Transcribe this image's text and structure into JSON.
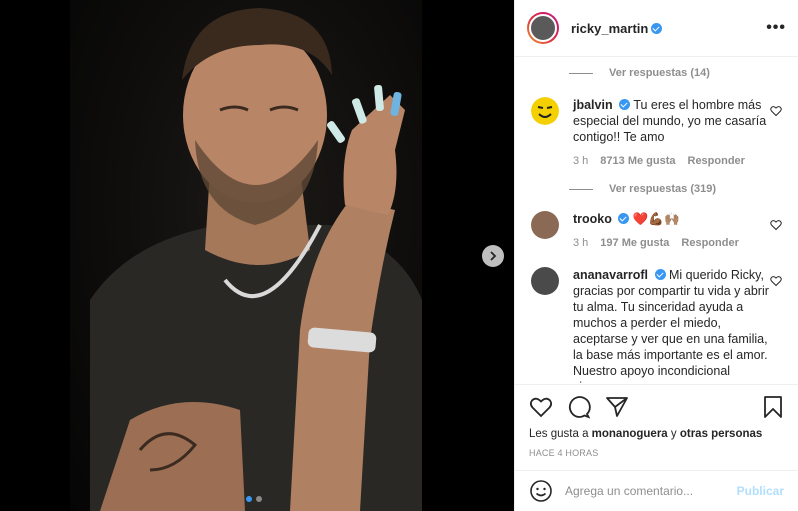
{
  "post": {
    "username": "ricky_martin",
    "more_icon": "more-options-icon",
    "carousel": {
      "total": 2,
      "current": 1
    }
  },
  "comments": {
    "replies_1": "Ver respuestas (14)",
    "c1": {
      "username": "jbalvin",
      "text": "Tu eres el hombre más especial del mundo, yo me casaría contigo!! Te amo",
      "time": "3 h",
      "likes": "8713 Me gusta",
      "reply": "Responder"
    },
    "replies_2": "Ver respuestas (319)",
    "c2": {
      "username": "trooko",
      "text": "❤️💪🏾🙌🏽",
      "time": "3 h",
      "likes": "197 Me gusta",
      "reply": "Responder"
    },
    "c3": {
      "username": "ananavarrofl",
      "text": "Mi querido Ricky, gracias por compartir tu vida y abrir tu alma. Tu sinceridad ayuda a muchos a perder el miedo, aceptarse y ver que en una familia, la base más importante es el amor. Nuestro apoyo incondicional siempre."
    }
  },
  "actions": {
    "liked_by_prefix": "Les gusta a ",
    "liked_by_user": "monanoguera",
    "liked_by_mid": " y ",
    "liked_by_others": "otras personas",
    "time": "HACE 4 HORAS"
  },
  "add_comment": {
    "placeholder": "Agrega un comentario...",
    "post_label": "Publicar"
  },
  "colors": {
    "accent": "#3897f0",
    "post_disabled": "#b2dffc",
    "heart": "#ed4956"
  }
}
